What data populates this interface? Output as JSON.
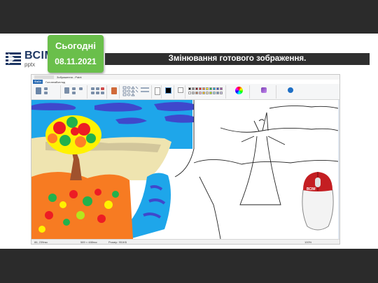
{
  "slide": {
    "brand_word": "ВСІМ",
    "brand_sub": "pptx",
    "today_label": "Сьогодні",
    "date": "08.11.2021",
    "title": "Змінювання готового зображення."
  },
  "paint": {
    "window_title": "Зображення - Paint",
    "menu": {
      "file": "Файл",
      "home": "Головна",
      "view": "Вигляд"
    },
    "status": {
      "coords": "86, 239пкс",
      "selection": "589 × 488пкс",
      "size": "Розмір: 951КБ",
      "zoom": "100%"
    },
    "palette": [
      "#000000",
      "#7f7f7f",
      "#880015",
      "#ed1c24",
      "#ff7f27",
      "#fff200",
      "#22b14c",
      "#00a2e8",
      "#3f48cc",
      "#a349a4",
      "#ffffff",
      "#c3c3c3",
      "#b97a57",
      "#ffaec9",
      "#ffc90e",
      "#efe4b0",
      "#b5e61d",
      "#99d9ea",
      "#7092be",
      "#c8bfe7"
    ]
  },
  "mouse": {
    "brand": "ВСІМ"
  },
  "colors": {
    "today_green": "#6abf4b",
    "title_dark": "#2f2f2f",
    "paint_blue": "#2b6cb3"
  }
}
